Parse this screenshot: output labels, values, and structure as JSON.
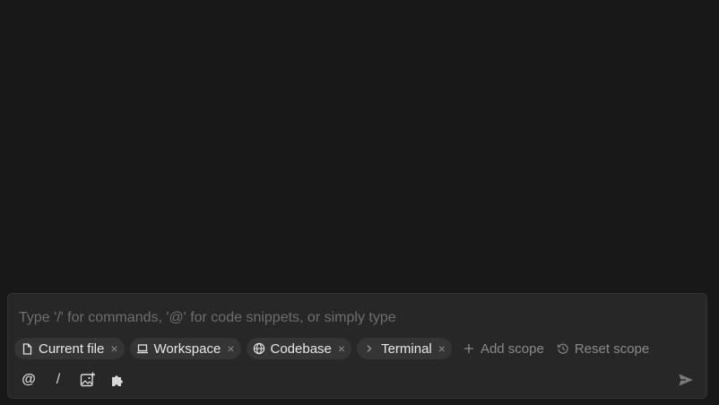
{
  "composer": {
    "placeholder": "Type '/' for commands, '@' for code snippets, or simply type"
  },
  "scopes": [
    {
      "label": "Current file",
      "icon": "file-icon",
      "remove": "×"
    },
    {
      "label": "Workspace",
      "icon": "laptop-icon",
      "remove": "×"
    },
    {
      "label": "Codebase",
      "icon": "globe-icon",
      "remove": "×"
    },
    {
      "label": "Terminal",
      "icon": "terminal-chevron-icon",
      "remove": "×"
    }
  ],
  "actions": {
    "add_scope": "Add scope",
    "reset_scope": "Reset scope"
  },
  "toolbar": {
    "mention": "@",
    "command": "/"
  },
  "colors": {
    "background": "#181818",
    "composer": "#272727",
    "chip": "#353535",
    "placeholder": "#6e6e6e"
  }
}
